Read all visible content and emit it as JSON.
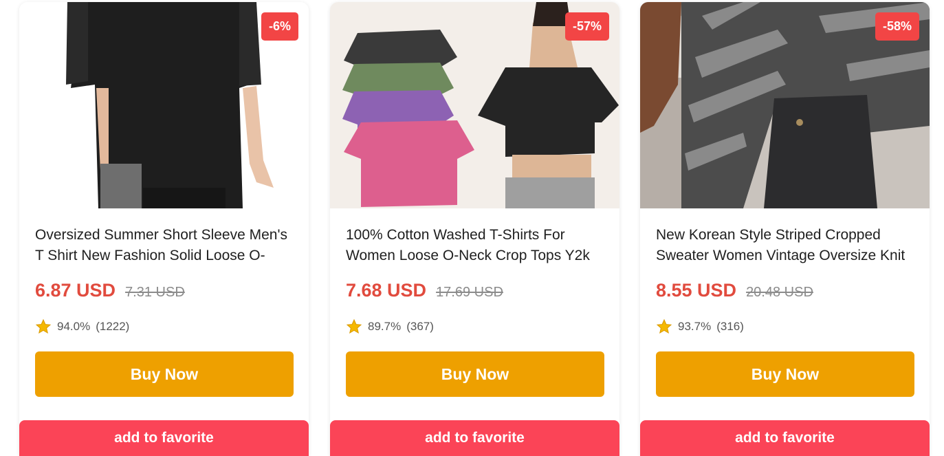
{
  "colors": {
    "price": "#e14b3e",
    "badge": "#f24545",
    "buy_button": "#eea000",
    "favorite_button": "#fb4457",
    "star": "#f5b800"
  },
  "products": [
    {
      "discount": "-6%",
      "title": "Oversized Summer Short Sleeve Men's T Shirt New Fashion Solid Loose O-",
      "price": "6.87 USD",
      "old_price": "7.31 USD",
      "rating": "94.0%",
      "reviews": "(1222)",
      "buy_label": "Buy Now",
      "favorite_label": "add to favorite",
      "icon": "star-icon"
    },
    {
      "discount": "-57%",
      "title": "100% Cotton Washed T-Shirts For Women Loose O-Neck Crop Tops Y2k",
      "price": "7.68 USD",
      "old_price": "17.69 USD",
      "rating": "89.7%",
      "reviews": "(367)",
      "buy_label": "Buy Now",
      "favorite_label": "add to favorite",
      "icon": "star-icon"
    },
    {
      "discount": "-58%",
      "title": "New Korean Style Striped Cropped Sweater Women Vintage Oversize Knit",
      "price": "8.55 USD",
      "old_price": "20.48 USD",
      "rating": "93.7%",
      "reviews": "(316)",
      "buy_label": "Buy Now",
      "favorite_label": "add to favorite",
      "icon": "star-icon"
    }
  ]
}
